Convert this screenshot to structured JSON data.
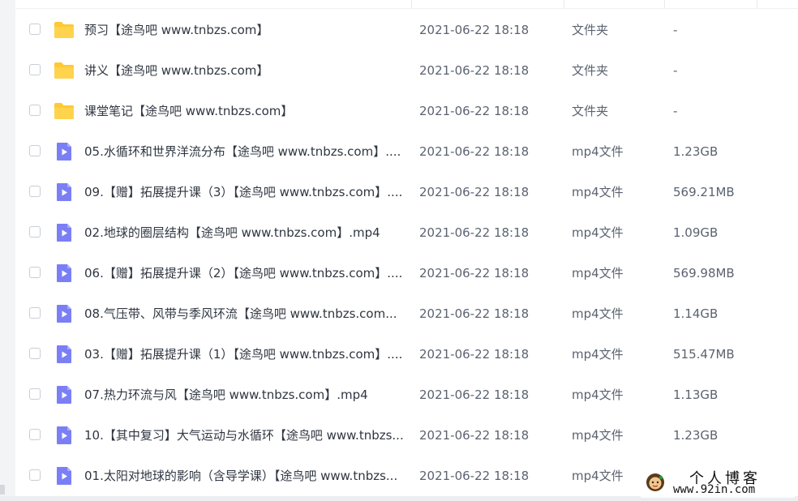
{
  "files": [
    {
      "name": "预习【途鸟吧 www.tnbzs.com】",
      "date": "2021-06-22 18:18",
      "type": "文件夹",
      "size": "-",
      "icon": "folder-icon"
    },
    {
      "name": "讲义【途鸟吧 www.tnbzs.com】",
      "date": "2021-06-22 18:18",
      "type": "文件夹",
      "size": "-",
      "icon": "folder-icon"
    },
    {
      "name": "课堂笔记【途鸟吧 www.tnbzs.com】",
      "date": "2021-06-22 18:18",
      "type": "文件夹",
      "size": "-",
      "icon": "folder-icon"
    },
    {
      "name": "05.水循环和世界洋流分布【途鸟吧 www.tnbzs.com】....",
      "date": "2021-06-22 18:18",
      "type": "mp4文件",
      "size": "1.23GB",
      "icon": "video-file-icon"
    },
    {
      "name": "09.【赠】拓展提升课（3）【途鸟吧 www.tnbzs.com】....",
      "date": "2021-06-22 18:18",
      "type": "mp4文件",
      "size": "569.21MB",
      "icon": "video-file-icon"
    },
    {
      "name": "02.地球的圈层结构【途鸟吧 www.tnbzs.com】.mp4",
      "date": "2021-06-22 18:18",
      "type": "mp4文件",
      "size": "1.09GB",
      "icon": "video-file-icon"
    },
    {
      "name": "06.【赠】拓展提升课（2）【途鸟吧 www.tnbzs.com】....",
      "date": "2021-06-22 18:18",
      "type": "mp4文件",
      "size": "569.98MB",
      "icon": "video-file-icon"
    },
    {
      "name": "08.气压带、风带与季风环流【途鸟吧 www.tnbzs.com...",
      "date": "2021-06-22 18:18",
      "type": "mp4文件",
      "size": "1.14GB",
      "icon": "video-file-icon"
    },
    {
      "name": "03.【赠】拓展提升课（1）【途鸟吧 www.tnbzs.com】....",
      "date": "2021-06-22 18:18",
      "type": "mp4文件",
      "size": "515.47MB",
      "icon": "video-file-icon"
    },
    {
      "name": "07.热力环流与风【途鸟吧 www.tnbzs.com】.mp4",
      "date": "2021-06-22 18:18",
      "type": "mp4文件",
      "size": "1.13GB",
      "icon": "video-file-icon"
    },
    {
      "name": "10.【其中复习】大气运动与水循环【途鸟吧 www.tnbzs...",
      "date": "2021-06-22 18:18",
      "type": "mp4文件",
      "size": "1.23GB",
      "icon": "video-file-icon"
    },
    {
      "name": "01.太阳对地球的影响（含导学课）【途鸟吧 www.tnbzs...",
      "date": "2021-06-22 18:18",
      "type": "mp4文件",
      "size": "",
      "icon": "video-file-icon"
    }
  ],
  "watermark": {
    "title": "个人博客",
    "url": "www.92in.com"
  },
  "colors": {
    "folder": "#ffc933",
    "video": "#7b7ff5",
    "text": "#2f3641",
    "muted": "#5b6370"
  }
}
